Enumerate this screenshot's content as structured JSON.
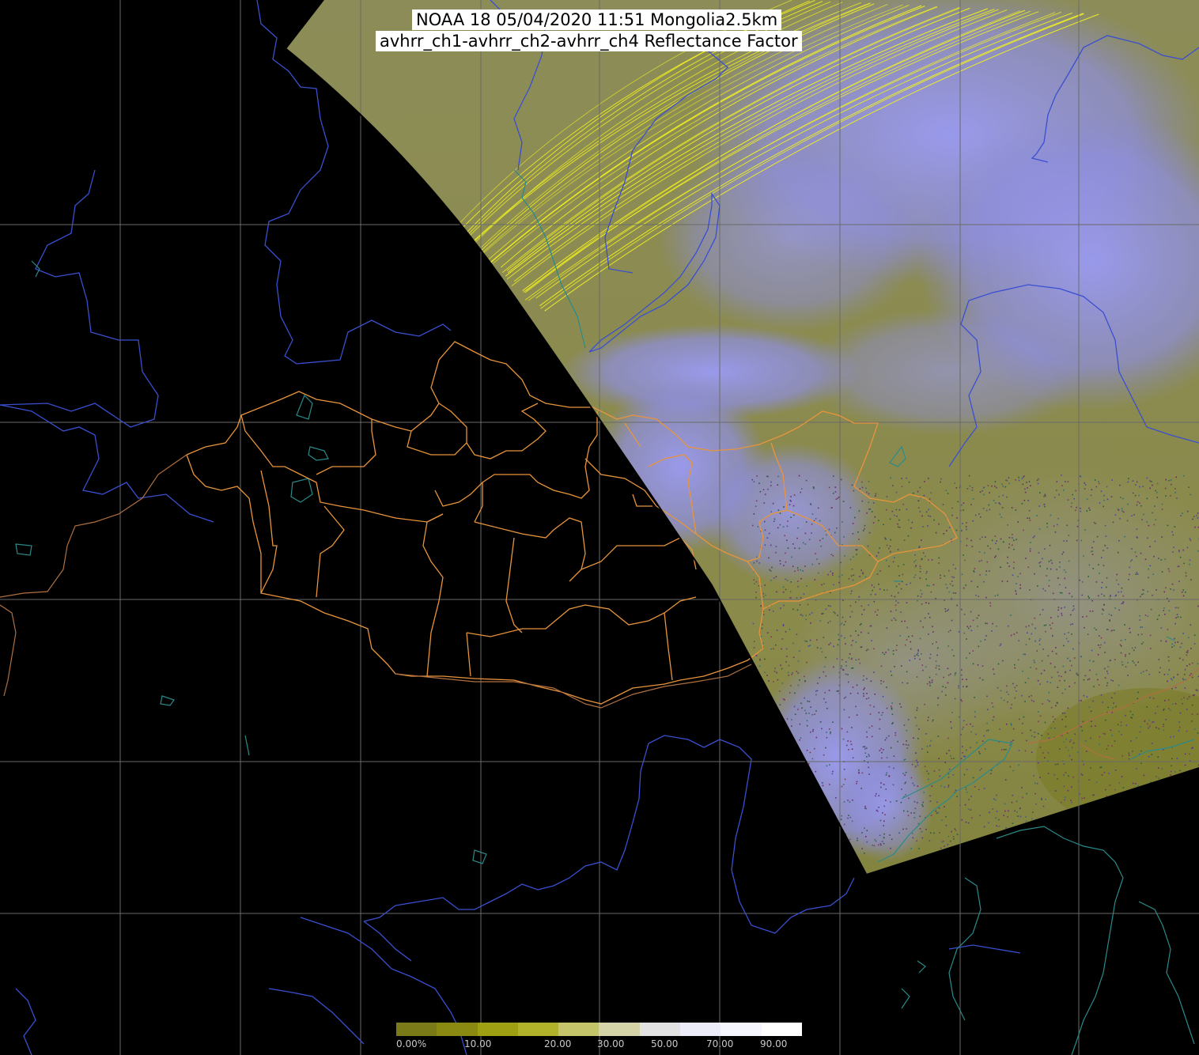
{
  "title": {
    "line1": "NOAA 18 05/04/2020 11:51 Mongolia2.5km",
    "line2": "avhrr_ch1-avhrr_ch2-avhrr_ch4 Reflectance Factor"
  },
  "colorbar": {
    "labels": [
      "0.00%",
      "10.00",
      "20.00",
      "30.00",
      "50.00",
      "70.00",
      "90.00"
    ],
    "colors": [
      "#7a7a18",
      "#8a8a12",
      "#9f9f14",
      "#b2b22a",
      "#c4c46a",
      "#d4d4a8",
      "#e2e2e2",
      "#ececf8",
      "#f6f6ff",
      "#ffffff"
    ]
  },
  "map_colors": {
    "background": "#000000",
    "swath_base": "#8a8a4c",
    "cloud": "#9898f0",
    "grid": "#6a6a6a",
    "rivers": "#3a4fd0",
    "coast": "#2a8a8a",
    "borders": "#e8943c",
    "scan_lines": "#f0f020"
  },
  "icons": [
    "satellite-swath",
    "graticule",
    "province-borders",
    "rivers",
    "lakes",
    "coastline"
  ]
}
